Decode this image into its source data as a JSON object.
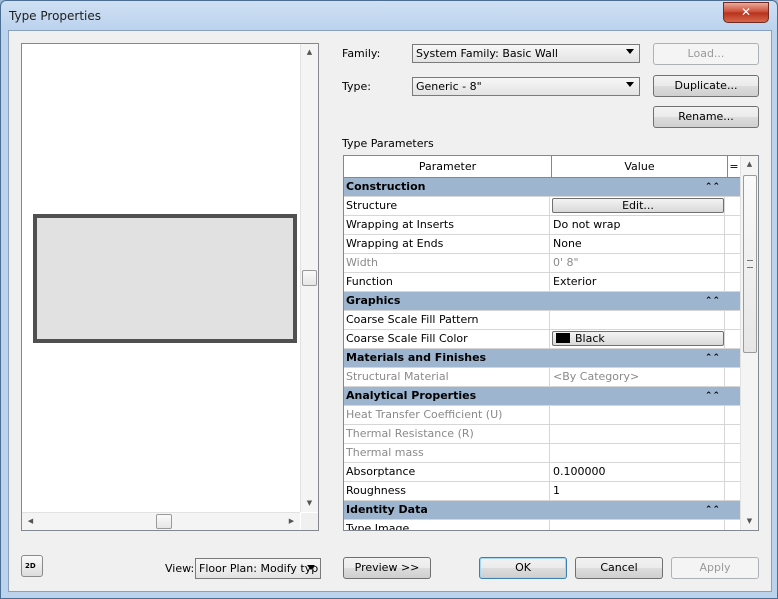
{
  "window": {
    "title": "Type Properties",
    "close_glyph": "✕"
  },
  "form": {
    "family_label": "Family:",
    "family_value": "System Family: Basic Wall",
    "type_label": "Type:",
    "type_value": "Generic - 8\"",
    "load_label": "Load...",
    "duplicate_label": "Duplicate...",
    "rename_label": "Rename...",
    "type_parameters_label": "Type Parameters"
  },
  "grid": {
    "col_parameter": "Parameter",
    "col_value": "Value",
    "col_sort": "=",
    "collapse_glyph": "⌃⌃",
    "rows": [
      {
        "kind": "group",
        "label": "Construction"
      },
      {
        "kind": "button",
        "param": "Structure",
        "value": "Edit..."
      },
      {
        "kind": "row",
        "param": "Wrapping at Inserts",
        "value": "Do not wrap"
      },
      {
        "kind": "row",
        "param": "Wrapping at Ends",
        "value": "None"
      },
      {
        "kind": "row",
        "param": "Width",
        "value": "0'  8\"",
        "dim": true
      },
      {
        "kind": "row",
        "param": "Function",
        "value": "Exterior"
      },
      {
        "kind": "group",
        "label": "Graphics"
      },
      {
        "kind": "row",
        "param": "Coarse Scale Fill Pattern",
        "value": ""
      },
      {
        "kind": "color",
        "param": "Coarse Scale Fill Color",
        "value": "Black",
        "color": "#000000"
      },
      {
        "kind": "group",
        "label": "Materials and Finishes"
      },
      {
        "kind": "row",
        "param": "Structural Material",
        "value": "<By Category>",
        "dim": true
      },
      {
        "kind": "group",
        "label": "Analytical Properties"
      },
      {
        "kind": "row",
        "param": "Heat Transfer Coefficient (U)",
        "value": "",
        "dim": true
      },
      {
        "kind": "row",
        "param": "Thermal Resistance (R)",
        "value": "",
        "dim": true
      },
      {
        "kind": "row",
        "param": "Thermal mass",
        "value": "",
        "dim": true
      },
      {
        "kind": "row",
        "param": "Absorptance",
        "value": "0.100000"
      },
      {
        "kind": "row",
        "param": "Roughness",
        "value": "1"
      },
      {
        "kind": "group",
        "label": "Identity Data"
      },
      {
        "kind": "row",
        "param": "Type Image",
        "value": ""
      }
    ]
  },
  "footer": {
    "view_label": "View:",
    "view_value": "Floor Plan: Modify typ",
    "preview_label": "Preview >>",
    "ok_label": "OK",
    "cancel_label": "Cancel",
    "apply_label": "Apply",
    "icon_badge": "2D"
  },
  "colors": {
    "group_header": "#9eb5cf",
    "title_bar": "#bcd3ee",
    "close_button": "#c9462f"
  }
}
